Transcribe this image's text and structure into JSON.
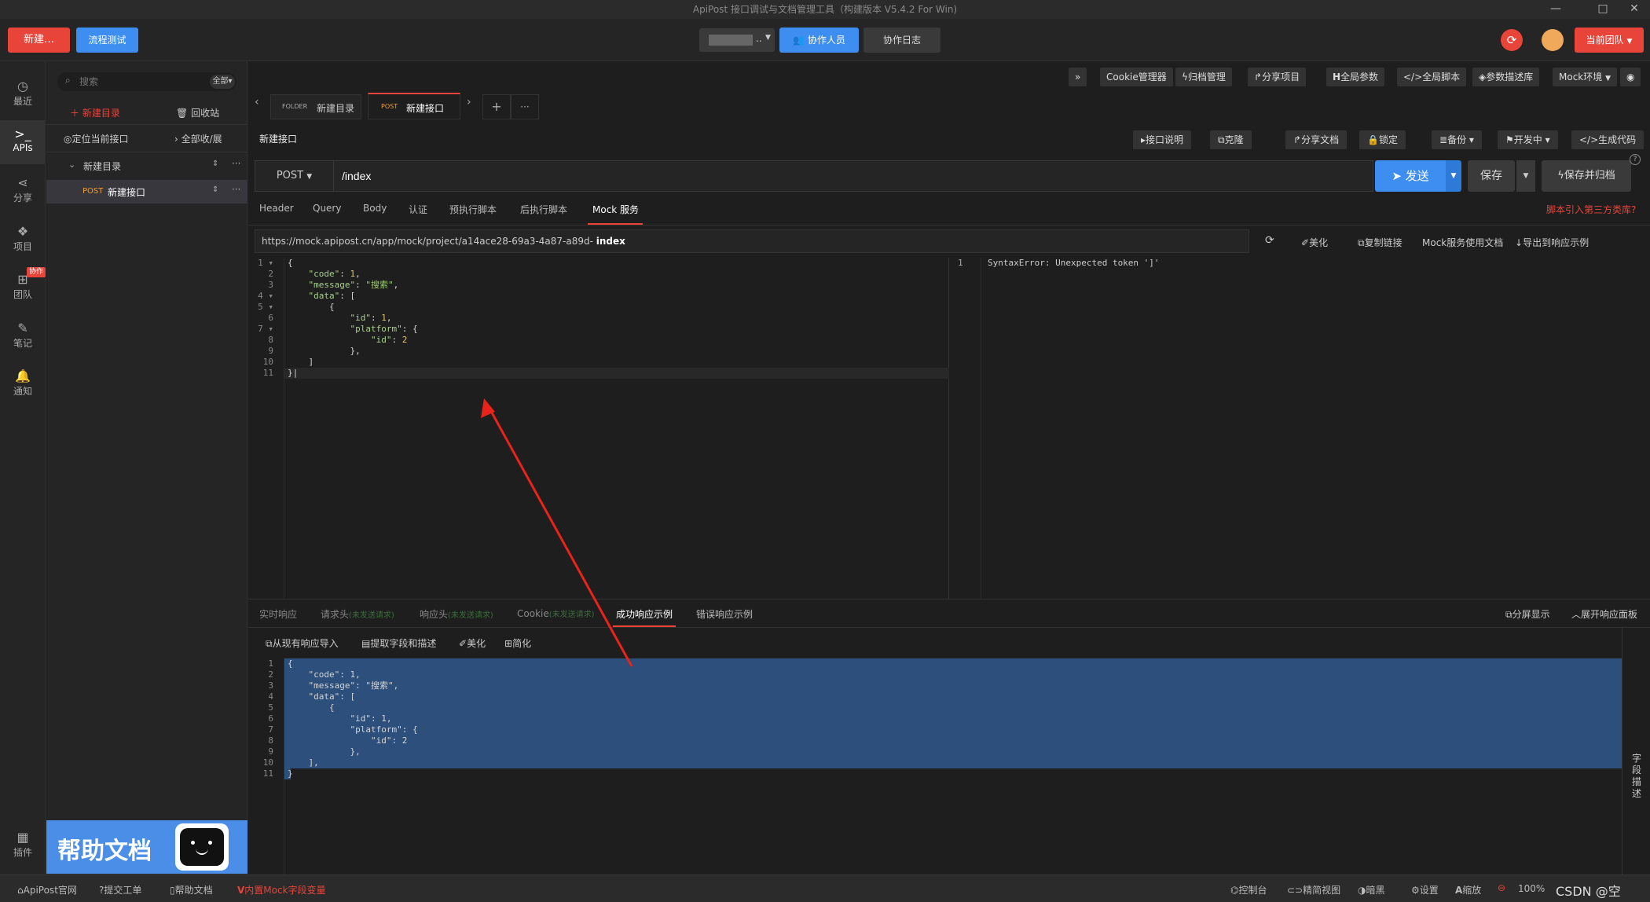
{
  "window": {
    "title": "ApiPost 接口调试与文档管理工具（构建版本 V5.4.2 For Win)"
  },
  "topbar": {
    "new_label": "新建…",
    "flow_label": "流程测试",
    "project_select": "..",
    "collaborators_label": "协作人员",
    "collab_log_label": "协作日志",
    "team_label": "当前团队"
  },
  "rail": {
    "items": [
      {
        "label": "最近",
        "icon": "clock-icon"
      },
      {
        "label": "APIs",
        "icon": "terminal-icon"
      },
      {
        "label": "分享",
        "icon": "share-icon"
      },
      {
        "label": "项目",
        "icon": "cubes-icon"
      },
      {
        "label": "团队",
        "icon": "sitemap-icon",
        "badge": "协作"
      },
      {
        "label": "笔记",
        "icon": "edit-icon"
      },
      {
        "label": "通知",
        "icon": "bell-icon"
      }
    ],
    "plugin_label": "插件"
  },
  "tree": {
    "search_placeholder": "搜索",
    "filter_label": "全部",
    "new_dir_label": "新建目录",
    "recycle_label": "回收站",
    "locate_label": "定位当前接口",
    "collapse_label": "全部收/展",
    "folder_name": "新建目录",
    "item_method": "POST",
    "item_name": "新建接口",
    "help_banner": "帮助文档"
  },
  "toolbar": {
    "items": [
      "»",
      "Cookie管理器",
      "归档管理",
      "分享项目",
      "全局参数",
      "全局脚本",
      "参数描述库",
      "Mock环境"
    ]
  },
  "tabs": {
    "folder_tag": "FOLDER",
    "folder_name": "新建目录",
    "post_tag": "POST",
    "post_name": "新建接口"
  },
  "request": {
    "title": "新建接口",
    "actions": [
      "接口说明",
      "克隆",
      "分享文档",
      "锁定",
      "备份",
      "开发中",
      "生成代码"
    ],
    "method": "POST",
    "url": "/index",
    "send_label": "发送",
    "save_label": "保存",
    "save_archive_label": "保存并归档",
    "subtabs": [
      "Header",
      "Query",
      "Body",
      "认证",
      "预执行脚本",
      "后执行脚本",
      "Mock 服务"
    ],
    "active_subtab": "Mock 服务",
    "third_party_link": "脚本引入第三方类库?"
  },
  "mock": {
    "url_prefix": "https://mock.apipost.cn/app/mock/project/a14ace28-69a3-4a87-a89d-",
    "url_suffix": "index",
    "beautify_label": "美化",
    "copy_link_label": "复制链接",
    "doc_label": "Mock服务使用文档",
    "export_label": "导出到响应示例",
    "error_text": "SyntaxError: Unexpected token ']'"
  },
  "response": {
    "tabs": [
      "实时响应",
      "请求头",
      "响应头",
      "Cookie",
      "成功响应示例",
      "错误响应示例"
    ],
    "pending": "(未发送请求)",
    "active_tab": "成功响应示例",
    "split_label": "分屏显示",
    "expand_label": "展开响应面板",
    "tools": [
      "从现有响应导入",
      "提取字段和描述",
      "美化",
      "简化"
    ],
    "side_label": "字段描述"
  },
  "status": {
    "left": [
      "ApiPost官网",
      "提交工单",
      "帮助文档",
      "内置Mock字段变量"
    ],
    "right": [
      "控制台",
      "精简视图",
      "暗黑",
      "设置",
      "缩放",
      "100%"
    ],
    "watermark": "CSDN @空"
  },
  "colors": {
    "accent_red": "#e8443a",
    "accent_blue": "#3d8ef0",
    "selection": "#2c4f7c"
  }
}
